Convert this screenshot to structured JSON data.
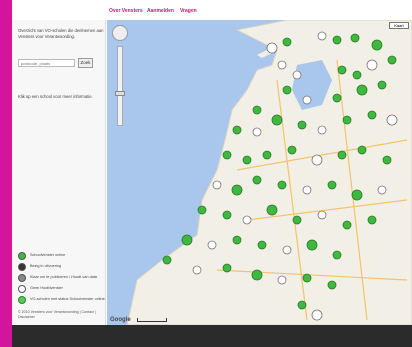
{
  "nav": {
    "items": [
      "Over Vensters",
      "Aanmelden",
      "Vragen"
    ]
  },
  "sidebar": {
    "intro": "Overzicht van VO-scholen die deelnemen aan Vensters voor Verantwoording.",
    "search_placeholder": "postcode, plaats",
    "search_button": "Zoek",
    "click_hint": "Klik op een school voor meer informatie.",
    "legend": [
      {
        "label": "Schoolvenster online",
        "icon": "green-school-icon",
        "color": "#3fb83f"
      },
      {
        "label": "Bezig in uitvoering",
        "icon": "dark-school-icon",
        "color": "#333333"
      },
      {
        "label": "Klaar om te publiceren / Houdt van data",
        "icon": "gray-school-icon",
        "color": "#888888"
      },
      {
        "label": "Geen Hoofdvenster",
        "icon": "white-school-icon",
        "color": "#ffffff"
      },
      {
        "label": "VO-scholen met status Schoolvenster online",
        "icon": "cluster-icon",
        "color": "#5cc85c"
      }
    ],
    "footer": "© 2010 Vensters voor Verantwoording | Contact | Disclaimer"
  },
  "map": {
    "map_type_button": "Kaart",
    "logo": "Google",
    "colors": {
      "water": "#a9c6ed",
      "land": "#f2efe6",
      "marker_green": "#3fb83f",
      "marker_white": "#ffffff"
    }
  },
  "colors": {
    "brand": "#d4149c",
    "nav_text": "#c0207a"
  }
}
